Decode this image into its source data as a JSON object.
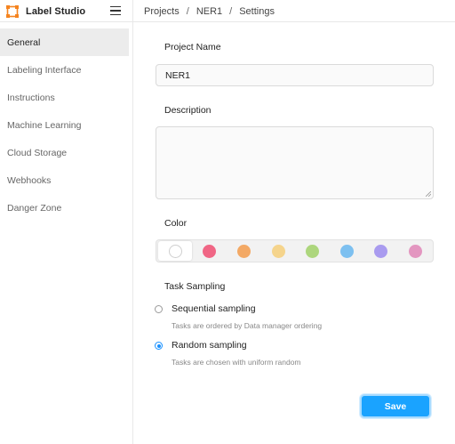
{
  "app": {
    "name": "Label Studio",
    "logo_icon": "label-studio-logo-icon",
    "accent": "#1890ff",
    "logo_color": "#f5841f"
  },
  "breadcrumb": {
    "items": [
      "Projects",
      "NER1",
      "Settings"
    ],
    "separator": "/"
  },
  "sidebar": {
    "items": [
      {
        "label": "General",
        "active": true
      },
      {
        "label": "Labeling Interface",
        "active": false
      },
      {
        "label": "Instructions",
        "active": false
      },
      {
        "label": "Machine Learning",
        "active": false
      },
      {
        "label": "Cloud Storage",
        "active": false
      },
      {
        "label": "Webhooks",
        "active": false
      },
      {
        "label": "Danger Zone",
        "active": false
      }
    ]
  },
  "form": {
    "project_name_label": "Project Name",
    "project_name_value": "NER1",
    "description_label": "Description",
    "description_value": "",
    "color_label": "Color",
    "colors": [
      "#ffffff",
      "#f06685",
      "#f3a965",
      "#f5d48c",
      "#add67d",
      "#7dc0f0",
      "#a99bef",
      "#e396c0"
    ],
    "selected_color_index": 0,
    "task_sampling_label": "Task Sampling",
    "sampling_options": [
      {
        "title": "Sequential sampling",
        "description": "Tasks are ordered by Data manager ordering",
        "checked": false
      },
      {
        "title": "Random sampling",
        "description": "Tasks are chosen with uniform random",
        "checked": true
      }
    ],
    "save_label": "Save"
  }
}
